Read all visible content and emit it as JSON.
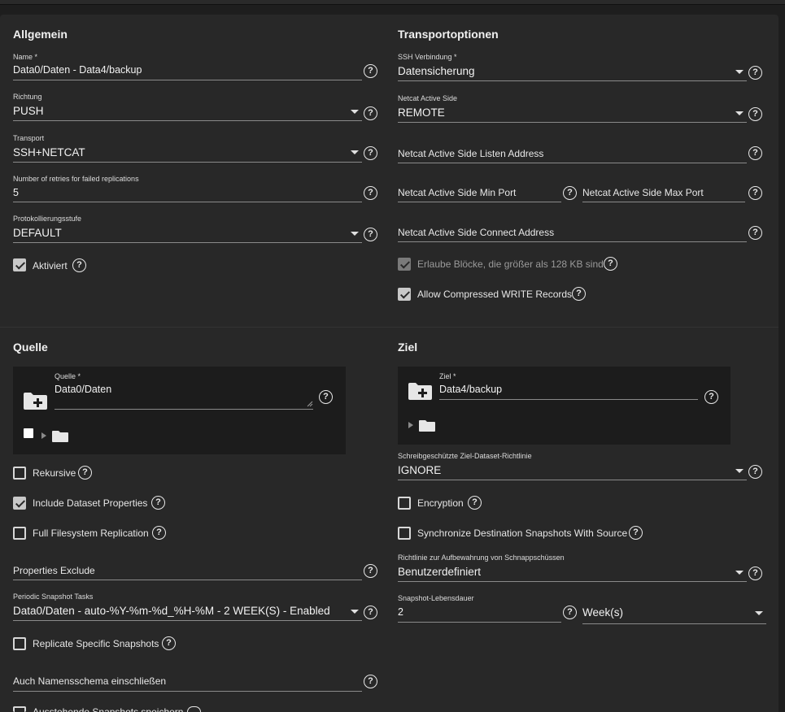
{
  "general": {
    "heading": "Allgemein",
    "name_label": "Name *",
    "name_value": "Data0/Daten - Data4/backup",
    "direction_label": "Richtung",
    "direction_value": "PUSH",
    "transport_label": "Transport",
    "transport_value": "SSH+NETCAT",
    "retries_label": "Number of retries for failed replications",
    "retries_value": "5",
    "loglevel_label": "Protokollierungsstufe",
    "loglevel_value": "DEFAULT",
    "enabled_label": "Aktiviert",
    "enabled_checked": true
  },
  "transport": {
    "heading": "Transportoptionen",
    "ssh_label": "SSH Verbindung *",
    "ssh_value": "Datensicherung",
    "netcat_side_label": "Netcat Active Side",
    "netcat_side_value": "REMOTE",
    "listen_address_placeholder": "Netcat Active Side Listen Address",
    "min_port_placeholder": "Netcat Active Side Min Port",
    "max_port_placeholder": "Netcat Active Side Max Port",
    "connect_address_placeholder": "Netcat Active Side Connect Address",
    "large_block_label": "Erlaube Blöcke, die größer als 128 KB sind",
    "large_block_checked": true,
    "compressed_label": "Allow Compressed WRITE Records",
    "compressed_checked": true
  },
  "source": {
    "heading": "Quelle",
    "source_label": "Quelle *",
    "source_value": "Data0/Daten",
    "recursive_label": "Rekursive",
    "recursive_checked": false,
    "include_props_label": "Include Dataset Properties",
    "include_props_checked": true,
    "full_fs_label": "Full Filesystem Replication",
    "full_fs_checked": false,
    "props_exclude_placeholder": "Properties Exclude",
    "periodic_label": "Periodic Snapshot Tasks",
    "periodic_value": "Data0/Daten - auto-%Y-%m-%d_%H-%M - 2 WEEK(S) - Enabled",
    "replicate_specific_label": "Replicate Specific Snapshots",
    "replicate_specific_checked": false,
    "naming_schema_placeholder": "Auch Namensschema einschließen",
    "pending_label": "Ausstehende Snapshots speichern"
  },
  "target": {
    "heading": "Ziel",
    "target_label": "Ziel *",
    "target_value": "Data4/backup",
    "readonly_label": "Schreibgeschützte Ziel-Dataset-Richtlinie",
    "readonly_value": "IGNORE",
    "encryption_label": "Encryption",
    "encryption_checked": false,
    "sync_label": "Synchronize Destination Snapshots With Source",
    "sync_checked": false,
    "retention_label": "Richtlinie zur Aufbewahrung von Schnappschüssen",
    "retention_value": "Benutzerdefiniert",
    "lifetime_label": "Snapshot-Lebensdauer",
    "lifetime_value": "2",
    "lifetime_unit": "Week(s)"
  },
  "icons": {
    "help": "help-circle-icon",
    "dropdown": "caret-down-icon",
    "folder_add": "folder-plus-icon",
    "folder": "folder-icon",
    "expand": "triangle-right-icon",
    "checkbox": "checkbox-icon"
  },
  "help_glyph": "?"
}
